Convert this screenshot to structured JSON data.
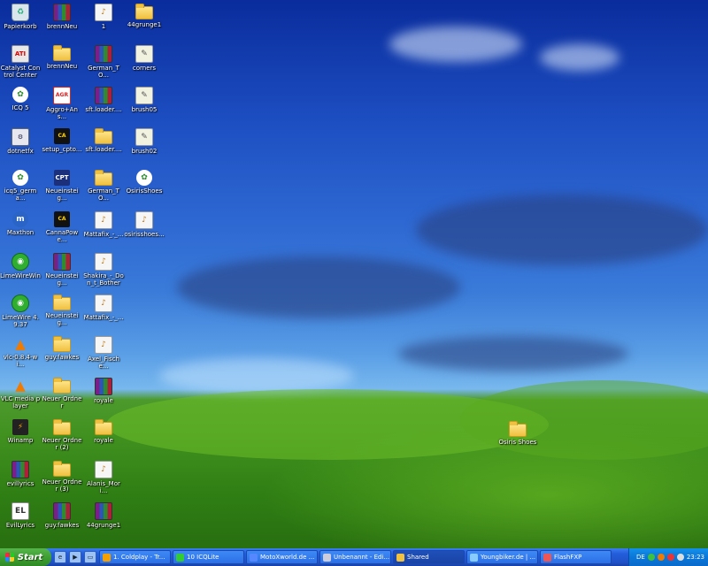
{
  "desktop": {
    "icons": [
      {
        "label": "Papierkorb",
        "kind": "bin",
        "icon": "recycle-bin-icon"
      },
      {
        "label": "brennNeu",
        "kind": "rar",
        "icon": "winrar-archive-icon"
      },
      {
        "label": "1",
        "kind": "doc",
        "icon": "document-icon"
      },
      {
        "label": "44grunge1",
        "kind": "folder",
        "icon": "folder-icon"
      },
      {
        "label": "Catalyst Control Center",
        "kind": "ati",
        "icon": "ati-icon"
      },
      {
        "label": "brennNeu",
        "kind": "folder",
        "icon": "folder-icon"
      },
      {
        "label": "German_TO...",
        "kind": "rar",
        "icon": "winrar-archive-icon"
      },
      {
        "label": "corners",
        "kind": "brush",
        "icon": "brush-file-icon"
      },
      {
        "label": "ICQ 5",
        "kind": "icq",
        "icon": "icq-flower-icon"
      },
      {
        "label": "Aggro+Ans...",
        "kind": "aggro",
        "icon": "image-file-icon"
      },
      {
        "label": "sft.loader....",
        "kind": "rar",
        "icon": "winrar-archive-icon"
      },
      {
        "label": "brush05",
        "kind": "brush",
        "icon": "brush-file-icon"
      },
      {
        "label": "dotnetfx",
        "kind": "exe",
        "icon": "installer-icon"
      },
      {
        "label": "setup_cpto...",
        "kind": "ca",
        "icon": "canna-setup-icon"
      },
      {
        "label": "sft.loader....",
        "kind": "folder",
        "icon": "folder-icon"
      },
      {
        "label": "brush02",
        "kind": "brush",
        "icon": "brush-file-icon"
      },
      {
        "label": "icq5_germa...",
        "kind": "icq",
        "icon": "icq-flower-icon"
      },
      {
        "label": "Neueinsteig...",
        "kind": "cpt",
        "icon": "cpt-wizard-icon"
      },
      {
        "label": "German_TO...",
        "kind": "folder",
        "icon": "folder-icon"
      },
      {
        "label": "OsirisShoes",
        "kind": "icq",
        "icon": "osiris-icon"
      },
      {
        "label": "Maxthon",
        "kind": "maxthon",
        "icon": "maxthon-icon"
      },
      {
        "label": "CannaPowe...",
        "kind": "ca",
        "icon": "canna-power-icon"
      },
      {
        "label": "Mattafix_-_...",
        "kind": "doc",
        "icon": "audio-file-icon"
      },
      {
        "label": "osirisshoes...",
        "kind": "doc",
        "icon": "document-icon"
      },
      {
        "label": "LimeWireWin",
        "kind": "lw",
        "icon": "limewire-icon"
      },
      {
        "label": "Neueinsteig...",
        "kind": "rar",
        "icon": "winrar-archive-icon"
      },
      {
        "label": "Shakira_-_Don_t_Bother",
        "kind": "doc",
        "icon": "audio-file-icon"
      },
      {
        "label": "",
        "kind": "none",
        "icon": ""
      },
      {
        "label": "LimeWire 4.9.37",
        "kind": "lw",
        "icon": "limewire-icon"
      },
      {
        "label": "Neueinsteig...",
        "kind": "folder",
        "icon": "folder-icon"
      },
      {
        "label": "Mattafix_-_...",
        "kind": "doc",
        "icon": "audio-file-icon"
      },
      {
        "label": "",
        "kind": "none",
        "icon": ""
      },
      {
        "label": "vlc-0.8.4-wi...",
        "kind": "vlc",
        "icon": "vlc-cone-icon"
      },
      {
        "label": "guy.fawkes",
        "kind": "folder",
        "icon": "folder-icon"
      },
      {
        "label": "Axel_Fische...",
        "kind": "doc",
        "icon": "audio-file-icon"
      },
      {
        "label": "",
        "kind": "none",
        "icon": ""
      },
      {
        "label": "VLC media player",
        "kind": "vlc",
        "icon": "vlc-cone-icon"
      },
      {
        "label": "Neuer Ordner",
        "kind": "folder",
        "icon": "folder-icon"
      },
      {
        "label": "royale",
        "kind": "rar",
        "icon": "winrar-archive-icon"
      },
      {
        "label": "",
        "kind": "none",
        "icon": ""
      },
      {
        "label": "Winamp",
        "kind": "winamp",
        "icon": "winamp-icon"
      },
      {
        "label": "Neuer Ordner (2)",
        "kind": "folder",
        "icon": "folder-icon"
      },
      {
        "label": "royale",
        "kind": "folder",
        "icon": "folder-icon"
      },
      {
        "label": "",
        "kind": "none",
        "icon": ""
      },
      {
        "label": "evillyrics",
        "kind": "rar",
        "icon": "winrar-archive-icon"
      },
      {
        "label": "Neuer Ordner (3)",
        "kind": "folder",
        "icon": "folder-icon"
      },
      {
        "label": "Alanis_Mori...",
        "kind": "doc",
        "icon": "audio-file-icon"
      },
      {
        "label": "",
        "kind": "none",
        "icon": ""
      },
      {
        "label": "EvilLyrics",
        "kind": "lyrics",
        "icon": "evillyrics-icon"
      },
      {
        "label": "guy.fawkes",
        "kind": "rar",
        "icon": "winrar-archive-icon"
      },
      {
        "label": "44grunge1",
        "kind": "rar",
        "icon": "winrar-archive-icon"
      },
      {
        "label": "",
        "kind": "none",
        "icon": ""
      }
    ],
    "loose_icon": {
      "label": "Osiris Shoes",
      "kind": "folder",
      "icon": "folder-icon"
    }
  },
  "taskbar": {
    "start_label": "Start",
    "quick_launch": [
      "browser-icon",
      "media-icon",
      "desktop-icon"
    ],
    "tasks": [
      {
        "label": "1. Coldplay - Tr...",
        "icon": "winamp-icon",
        "active": false
      },
      {
        "label": "10 ICQLite",
        "icon": "icq-flower-icon",
        "active": false
      },
      {
        "label": "MotoXworld.de ...",
        "icon": "maxthon-icon",
        "active": false
      },
      {
        "label": "Unbenannt - Edi...",
        "icon": "editor-icon",
        "active": false
      },
      {
        "label": "Shared",
        "icon": "folder-icon",
        "active": true
      },
      {
        "label": "Youngbiker.de | ...",
        "icon": "browser-icon",
        "active": false
      },
      {
        "label": "FlashFXP",
        "icon": "ftp-icon",
        "active": false
      }
    ],
    "tray": {
      "lang": "DE",
      "clock": "23:23"
    }
  }
}
